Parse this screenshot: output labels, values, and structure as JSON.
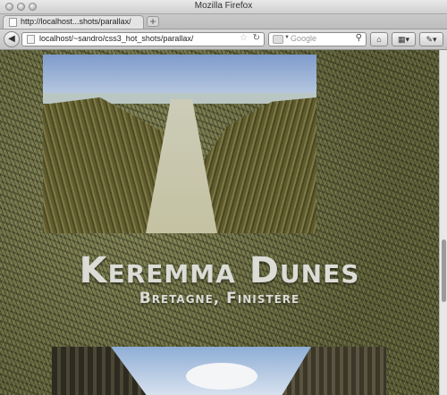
{
  "window": {
    "title": "Mozilla Firefox"
  },
  "tab": {
    "label": "http://localhost...shots/parallax/",
    "new_tab": "+"
  },
  "navbar": {
    "back": "◀",
    "url": "localhost/~sandro/css3_hot_shots/parallax/",
    "star": "☆",
    "reload": "↻",
    "search_placeholder": "Google",
    "search_icon": "search-icon",
    "home": "⌂",
    "bookmarks": "▦▾",
    "tools": "✎▾"
  },
  "page": {
    "headline": "Keremma Dunes",
    "subheadline": "Bretagne, Finistére"
  }
}
